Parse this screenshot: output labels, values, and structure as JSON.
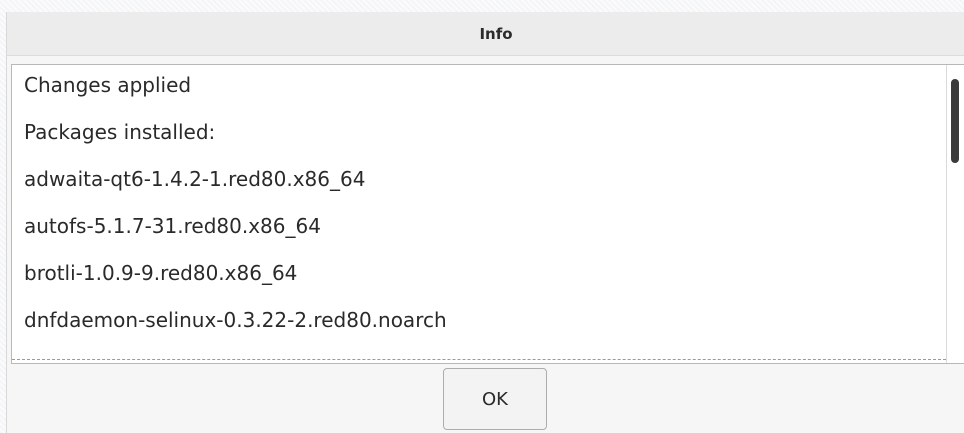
{
  "dialog": {
    "title": "Info",
    "messages": [
      "Changes applied",
      "Packages installed:",
      "adwaita-qt6-1.4.2-1.red80.x86_64",
      "autofs-5.1.7-31.red80.x86_64",
      "brotli-1.0.9-9.red80.x86_64",
      "dnfdaemon-selinux-0.3.22-2.red80.noarch"
    ],
    "ok_label": "OK"
  }
}
